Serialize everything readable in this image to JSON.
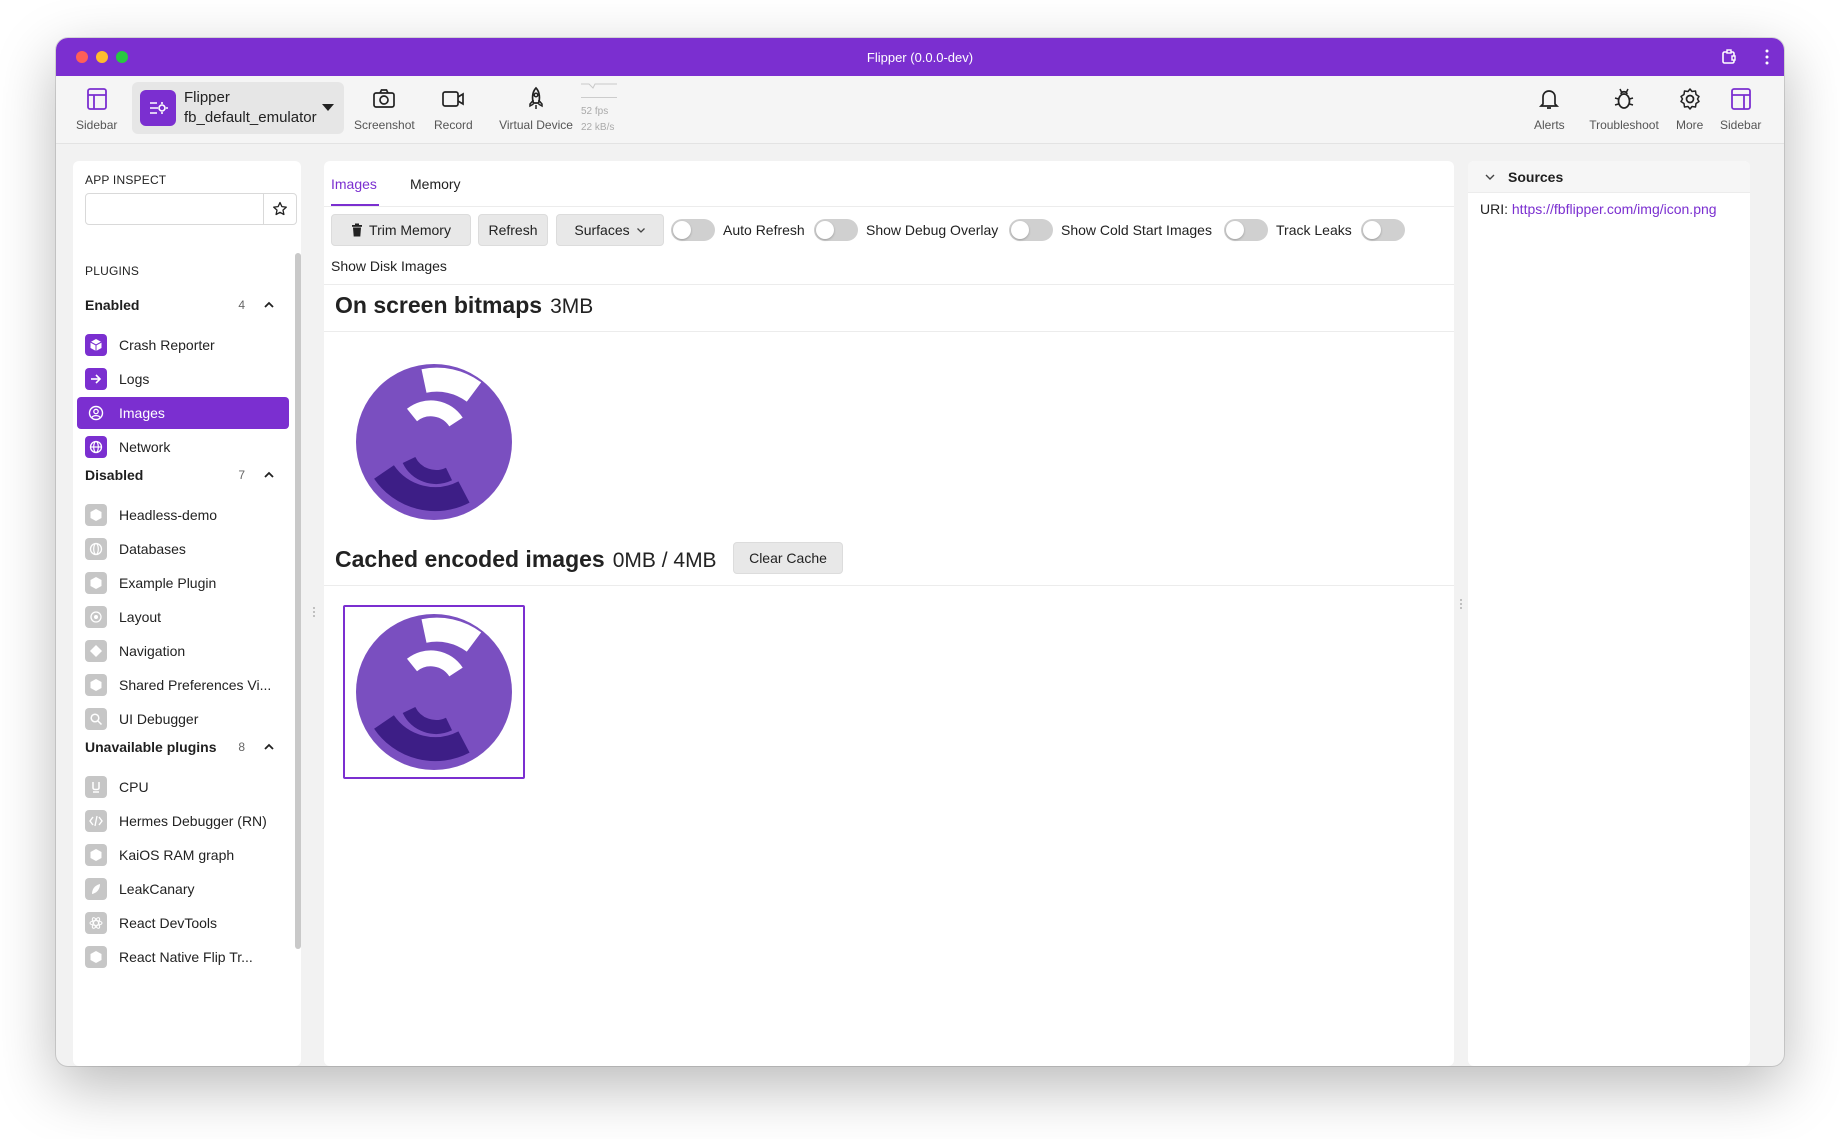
{
  "window": {
    "title": "Flipper (0.0.0-dev)"
  },
  "toolbar": {
    "left_sidebar_label": "Sidebar",
    "device": {
      "app": "Flipper",
      "name": "fb_default_emulator"
    },
    "screenshot_label": "Screenshot",
    "record_label": "Record",
    "virtual_device_label": "Virtual Device",
    "perf": {
      "fps": "52 fps",
      "bandwidth": "22 kB/s"
    },
    "alerts_label": "Alerts",
    "troubleshoot_label": "Troubleshoot",
    "more_label": "More",
    "right_sidebar_label": "Sidebar"
  },
  "sidebar": {
    "app_inspect_label": "APP INSPECT",
    "search_placeholder": "",
    "plugins_label": "PLUGINS",
    "groups": [
      {
        "title": "Enabled",
        "count": "4",
        "items": [
          {
            "label": "Crash Reporter",
            "icon": "crash-icon"
          },
          {
            "label": "Logs",
            "icon": "logs-icon"
          },
          {
            "label": "Images",
            "icon": "images-icon",
            "selected": true
          },
          {
            "label": "Network",
            "icon": "network-icon"
          }
        ]
      },
      {
        "title": "Disabled",
        "count": "7",
        "items": [
          {
            "label": "Headless-demo",
            "icon": "box-icon"
          },
          {
            "label": "Databases",
            "icon": "database-icon"
          },
          {
            "label": "Example Plugin",
            "icon": "box-icon"
          },
          {
            "label": "Layout",
            "icon": "layout-icon"
          },
          {
            "label": "Navigation",
            "icon": "navigation-icon"
          },
          {
            "label": "Shared Preferences Vi...",
            "icon": "box-icon"
          },
          {
            "label": "UI Debugger",
            "icon": "search-icon"
          }
        ]
      },
      {
        "title": "Unavailable plugins",
        "count": "8",
        "items": [
          {
            "label": "CPU",
            "icon": "cpu-icon"
          },
          {
            "label": "Hermes Debugger (RN)",
            "icon": "code-icon"
          },
          {
            "label": "KaiOS RAM graph",
            "icon": "box-icon"
          },
          {
            "label": "LeakCanary",
            "icon": "leak-icon"
          },
          {
            "label": "React DevTools",
            "icon": "react-icon"
          },
          {
            "label": "React Native Flip Tr...",
            "icon": "box-icon"
          }
        ]
      }
    ]
  },
  "main": {
    "tabs": [
      {
        "label": "Images",
        "active": true
      },
      {
        "label": "Memory"
      }
    ],
    "controls": {
      "trim_memory": "Trim Memory",
      "refresh": "Refresh",
      "surfaces": "Surfaces",
      "auto_refresh": "Auto Refresh",
      "show_debug_overlay": "Show Debug Overlay",
      "show_cold_start": "Show Cold Start Images",
      "track_leaks": "Track Leaks",
      "show_disk_images": "Show Disk Images"
    },
    "on_screen": {
      "title": "On screen bitmaps",
      "size": "3MB"
    },
    "cached": {
      "title": "Cached encoded images",
      "size": "0MB / 4MB",
      "clear_cache": "Clear Cache"
    }
  },
  "right_panel": {
    "title": "Sources",
    "uri_label": "URI:",
    "uri": "https://fbflipper.com/img/icon.png"
  },
  "colors": {
    "accent": "#7b2fd0",
    "logo_fill": "#7a4fc0",
    "logo_dark": "#3d1e86"
  }
}
